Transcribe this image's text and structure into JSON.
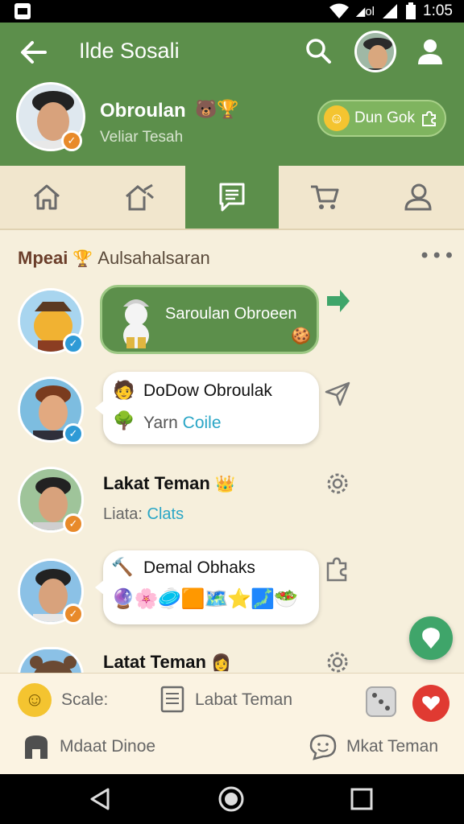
{
  "status_bar": {
    "time": "1:05"
  },
  "header": {
    "title": "Ilde Sosali",
    "profile_name": "Obroulan",
    "profile_subtitle": "Veliar Tesah",
    "join_button": "Dun Gok"
  },
  "tabs": [
    {
      "icon": "home-icon"
    },
    {
      "icon": "house-hammer-icon"
    },
    {
      "icon": "chat-list-icon",
      "active": true
    },
    {
      "icon": "cart-icon"
    },
    {
      "icon": "people-icon"
    }
  ],
  "feed": {
    "title_bold": "Mpeai",
    "title_rest": "Aulsahalsaran",
    "rows": [
      {
        "bubble": "Saroulan Obroeen"
      },
      {
        "line1": "DoDow Obroulak",
        "line2_prefix": "Yarn",
        "line2_accent": "Coile"
      },
      {
        "name": "Lakat Teman",
        "sub_prefix": "Liata:",
        "sub_accent": "Clats"
      },
      {
        "line1": "Demal Obhaks"
      },
      {
        "name": "Latat Teman"
      }
    ]
  },
  "bottom": {
    "scale_label": "Scale:",
    "list_label": "Labat Teman",
    "profile_label": "Mdaat Dinoe",
    "chat_label": "Mkat Teman"
  },
  "colors": {
    "brand_green": "#5c8f4b",
    "accent_blue": "#2aa6c6",
    "heart_red": "#e03a32"
  }
}
